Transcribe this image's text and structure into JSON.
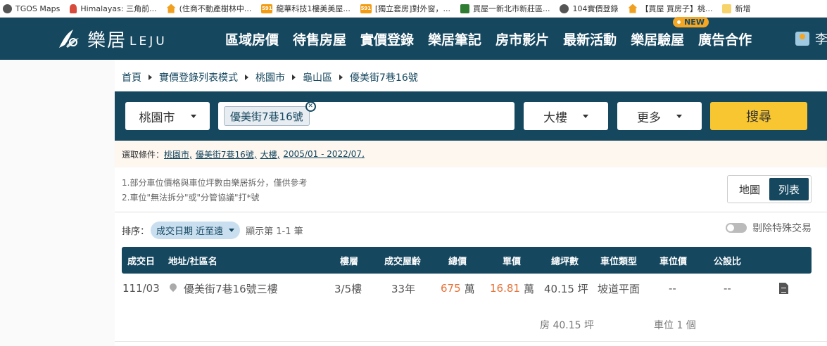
{
  "bookmarks": [
    {
      "label": "TGOS Maps",
      "icon": "globe-icon"
    },
    {
      "label": "Himalayas: 三角前...",
      "icon": "runner-icon"
    },
    {
      "label": "(住商不動產樹林中...",
      "icon": "house-icon"
    },
    {
      "label": "龍華科技1樓美美屋...",
      "icon": "591-icon"
    },
    {
      "label": "[獨立套房]對外窗，...",
      "icon": "591-icon"
    },
    {
      "label": "買屋一新北市新莊區...",
      "icon": "grid-icon"
    },
    {
      "label": "104實價登錄",
      "icon": "globe-icon"
    },
    {
      "label": "【買屋 買房子】桃...",
      "icon": "house-icon"
    },
    {
      "label": "新增",
      "icon": "folder-icon"
    }
  ],
  "header": {
    "logo_cn": "樂居",
    "logo_en": "LEJU",
    "nav": [
      "區域房價",
      "待售房屋",
      "實價登錄",
      "樂居筆記",
      "房市影片",
      "最新活動",
      "樂居驗屋",
      "廣告合作"
    ],
    "new_badge": "NEW",
    "user_name": "李"
  },
  "breadcrumb": [
    "首頁",
    "實價登錄列表模式",
    "桃園市",
    "龜山區",
    "優美街7巷16號"
  ],
  "search": {
    "city": "桃園市",
    "tag": "優美街7巷16號",
    "type": "大樓",
    "more": "更多",
    "button": "搜尋"
  },
  "conditions": {
    "label": "選取條件：",
    "items": [
      "桃園市,",
      "優美街7巷16號,",
      "大樓,",
      "2005/01 - 2022/07,"
    ]
  },
  "notes": [
    "1.部分車位價格與車位坪數由樂居拆分，僅供參考",
    "2.車位\"無法拆分\"或\"分管協議\"打*號"
  ],
  "view": {
    "map": "地圖",
    "list": "列表"
  },
  "sort": {
    "label": "排序：",
    "selected": "成交日期 近至遠",
    "count": "顯示第 1-1 筆",
    "special": "剔除特殊交易"
  },
  "table": {
    "headers": [
      "成交日",
      "地址/社區名",
      "樓層",
      "成交屋齡",
      "總價",
      "單價",
      "總坪數",
      "車位類型",
      "車位價",
      "公設比"
    ],
    "rows": [
      {
        "date": "111/03",
        "address": "優美街7巷16號三樓",
        "floor": "3/5樓",
        "age": "33年",
        "total_price": "675",
        "total_unit": "萬",
        "unit_price": "16.81",
        "unit_unit": "萬",
        "area": "40.15 坪",
        "parking_type": "坡道平面",
        "parking_price": "--",
        "public_ratio": "--",
        "house_area": "房 40.15 坪",
        "parking_count": "車位 1 個"
      }
    ]
  },
  "colors": {
    "header": "#15475f",
    "accent": "#f7c631",
    "price": "#e8733a"
  }
}
